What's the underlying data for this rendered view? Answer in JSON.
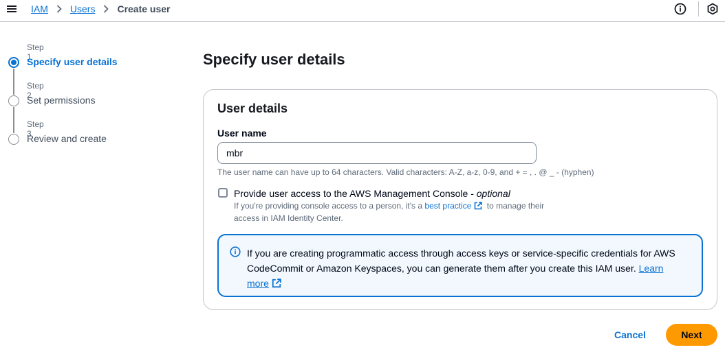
{
  "breadcrumb": {
    "items": [
      "IAM",
      "Users"
    ],
    "current": "Create user"
  },
  "icons": {
    "menu": "hamburger-menu-icon",
    "info": "info-icon",
    "notifications": "notification-icon"
  },
  "steps": [
    {
      "number": "Step 1",
      "title": "Specify user details",
      "active": true
    },
    {
      "number": "Step 2",
      "title": "Set permissions",
      "active": false
    },
    {
      "number": "Step 3",
      "title": "Review and create",
      "active": false
    }
  ],
  "page": {
    "title": "Specify user details"
  },
  "user_details": {
    "header": "User details",
    "username_label": "User name",
    "username_value": "mbr",
    "username_constraint": "The user name can have up to 64 characters. Valid characters: A-Z, a-z, 0-9, and + = , . @ _ - (hyphen)",
    "console_access_label": "Provide user access to the AWS Management Console - ",
    "console_access_optional": "optional",
    "console_access_checked": false,
    "console_desc_before": "If you're providing console access to a person, it's a ",
    "console_desc_link": "best practice",
    "console_desc_after": " to manage their access in IAM Identity Center."
  },
  "info_alert": {
    "text": "If you are creating programmatic access through access keys or service-specific credentials for AWS CodeCommit or Amazon Keyspaces, you can generate them after you create this IAM user. ",
    "link": "Learn more"
  },
  "actions": {
    "cancel": "Cancel",
    "next": "Next"
  },
  "colors": {
    "accent": "#0972d3",
    "primary_button": "#ff9900",
    "alert_background": "#f2f8fd"
  }
}
